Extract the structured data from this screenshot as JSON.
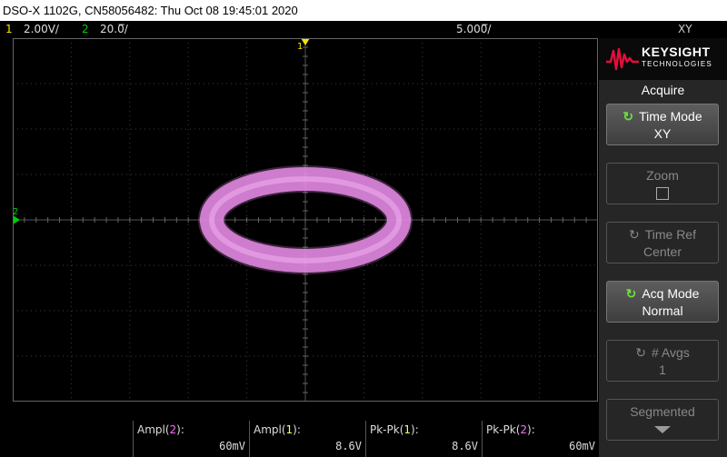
{
  "title_bar": {
    "text": "DSO-X 1102G, CN58056482: Thu Oct 08 19:45:01 2020"
  },
  "status_line": {
    "ch1_number": "1",
    "ch1_scale": "2.00V/",
    "ch2_number": "2",
    "ch2_scale": "20.0̅/",
    "time_scale": "5.000̅/",
    "mode_label": "XY"
  },
  "display": {
    "mode": "XY",
    "grid_divisions": {
      "horizontal": 10,
      "vertical": 8
    },
    "trace_color": "#e98ce9",
    "trigger_marker_color": "#f2e600",
    "ch2_marker_label": "2",
    "ch2_marker_color": "#00d000",
    "trace": {
      "shape": "ellipse",
      "x_half_width_div": 1.6,
      "y_half_height_div": 0.9,
      "center_div": [
        0.0,
        0.0
      ]
    }
  },
  "brand": {
    "name": "KEYSIGHT",
    "subtitle": "TECHNOLOGIES",
    "accent": "#e0103a"
  },
  "menu": {
    "title": "Acquire",
    "softkeys": [
      {
        "label": "Time Mode",
        "value": "XY",
        "active": true,
        "icon": "rotate-icon"
      },
      {
        "label": "Zoom",
        "value": "",
        "active": false,
        "icon": "checkbox-icon"
      },
      {
        "label": "Time Ref",
        "value": "Center",
        "active": false,
        "icon": "rotate-icon"
      },
      {
        "label": "Acq Mode",
        "value": "Normal",
        "active": true,
        "icon": "rotate-icon"
      },
      {
        "label": "# Avgs",
        "value": "1",
        "active": false,
        "icon": "rotate-icon"
      },
      {
        "label": "Segmented",
        "value": "",
        "active": false,
        "icon": "arrow-down-icon"
      }
    ]
  },
  "measurements": [
    {
      "name": "Ampl",
      "channel": "2",
      "value": "60mV"
    },
    {
      "name": "Ampl",
      "channel": "1",
      "value": "8.6V"
    },
    {
      "name": "Pk-Pk",
      "channel": "1",
      "value": "8.6V"
    },
    {
      "name": "Pk-Pk",
      "channel": "2",
      "value": "60mV"
    }
  ]
}
